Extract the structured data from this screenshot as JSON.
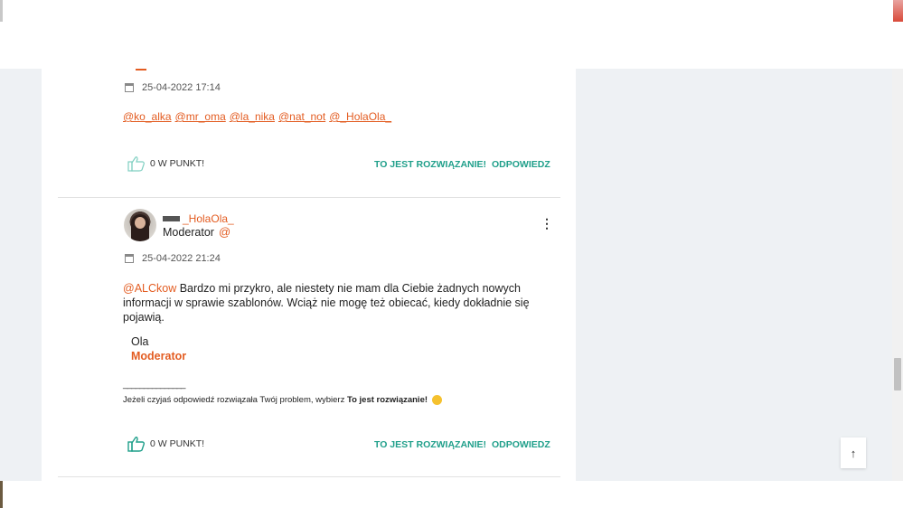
{
  "post1": {
    "date": "25-04-2022 17:14",
    "mentions": [
      "@ko_alka",
      "@mr_oma",
      "@la_nika",
      "@nat_not",
      "@_HolaOla_"
    ],
    "kudos": "0 W PUNKT!",
    "solution_label": "TO JEST ROZWIĄZANIE!",
    "reply_label": "ODPOWIEDZ"
  },
  "post2": {
    "username": "_HolaOla_",
    "role": "Moderator",
    "date": "25-04-2022 21:24",
    "mention": "@ALCkow",
    "body_rest": " Bardzo mi przykro, ale niestety nie mam dla Ciebie żadnych nowych informacji w sprawie szablonów. Wciąż nie mogę też obiecać, kiedy dokładnie się pojawią.",
    "signature_name": "Ola",
    "signature_role": "Moderator",
    "signature_line": "_______________",
    "signature_text": "Jeżeli czyjaś odpowiedź rozwiązała Twój problem, wybierz ",
    "signature_bold": "To jest rozwiązanie!",
    "kudos": "0 W PUNKT!",
    "solution_label": "TO JEST ROZWIĄZANIE!",
    "reply_label": "ODPOWIEDZ"
  },
  "scroll_top_icon": "arrow-up-icon",
  "colors": {
    "accent_orange": "#e35c21",
    "accent_teal": "#1f9f8a"
  }
}
